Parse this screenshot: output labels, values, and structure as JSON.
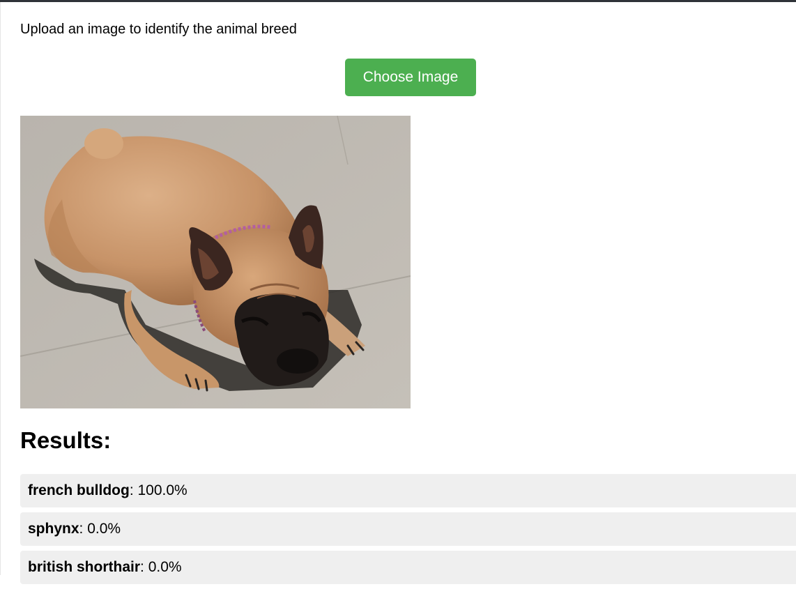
{
  "instruction": "Upload an image to identify the animal breed",
  "upload": {
    "button_label": "Choose Image"
  },
  "preview": {
    "subject": "french bulldog lying on pavement"
  },
  "results": {
    "heading": "Results:",
    "items": [
      {
        "breed": "french bulldog",
        "separator": ": ",
        "confidence": "100.0%"
      },
      {
        "breed": "sphynx",
        "separator": ": ",
        "confidence": "0.0%"
      },
      {
        "breed": "british shorthair",
        "separator": ": ",
        "confidence": "0.0%"
      }
    ]
  },
  "colors": {
    "button_bg": "#4caf50",
    "row_bg": "#efefef",
    "top_border": "#2f3338"
  }
}
